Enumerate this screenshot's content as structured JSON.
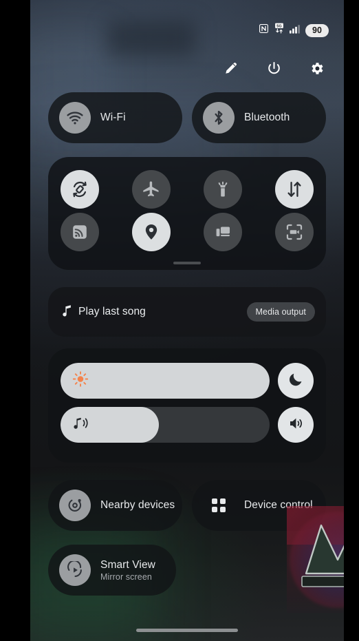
{
  "status_bar": {
    "nfc_icon": "nfc-icon",
    "network_icon": "5g-data-icon",
    "network_label": "5G",
    "signal_icon": "signal-bars-icon",
    "battery_level": "90"
  },
  "header": {
    "edit_label": "pencil-icon",
    "power_label": "power-icon",
    "settings_label": "gear-icon"
  },
  "connectivity": {
    "wifi": {
      "label": "Wi-Fi",
      "icon": "wifi-icon",
      "state": "off"
    },
    "bluetooth": {
      "label": "Bluetooth",
      "icon": "bluetooth-icon",
      "state": "off"
    }
  },
  "tiles": {
    "row1": [
      {
        "name": "auto-rotate",
        "icon": "auto-rotate-icon",
        "state": "on"
      },
      {
        "name": "airplane-mode",
        "icon": "airplane-icon",
        "state": "off"
      },
      {
        "name": "flashlight",
        "icon": "flashlight-icon",
        "state": "off"
      },
      {
        "name": "mobile-data",
        "icon": "data-transfer-icon",
        "state": "on"
      }
    ],
    "row2": [
      {
        "name": "smart-view-cast",
        "icon": "cast-icon",
        "state": "off"
      },
      {
        "name": "location",
        "icon": "location-pin-icon",
        "state": "on"
      },
      {
        "name": "link-to-windows",
        "icon": "multi-device-icon",
        "state": "off"
      },
      {
        "name": "screen-recorder",
        "icon": "screen-record-icon",
        "state": "off"
      }
    ],
    "page_handle": "drag-handle"
  },
  "media": {
    "icon": "music-note-icon",
    "title": "Play last song",
    "output_button": "Media output"
  },
  "sliders": {
    "brightness": {
      "icon": "brightness-sun-icon",
      "value": 100,
      "fill_percent": "100%",
      "action_icon": "dark-mode-moon-icon",
      "action_name": "dark-mode-toggle"
    },
    "volume": {
      "icon": "media-volume-icon",
      "value": 47,
      "fill_percent": "47%",
      "action_icon": "speaker-icon",
      "action_name": "sound-settings"
    }
  },
  "bottom_tiles": {
    "nearby_devices": {
      "label": "Nearby devices",
      "icon": "nearby-share-icon"
    },
    "device_control": {
      "label": "Device control",
      "icon": "grid-dots-icon"
    },
    "smart_view": {
      "label": "Smart View",
      "sublabel": "Mirror screen",
      "icon": "smart-view-play-icon"
    }
  },
  "colors": {
    "tile_on": "#dcdfe1",
    "tile_off": "#45484b",
    "brightness_accent": "#f4834c",
    "panel_bg": "#15171a",
    "text_primary": "#e8eaec",
    "text_secondary": "#a7abaf"
  }
}
